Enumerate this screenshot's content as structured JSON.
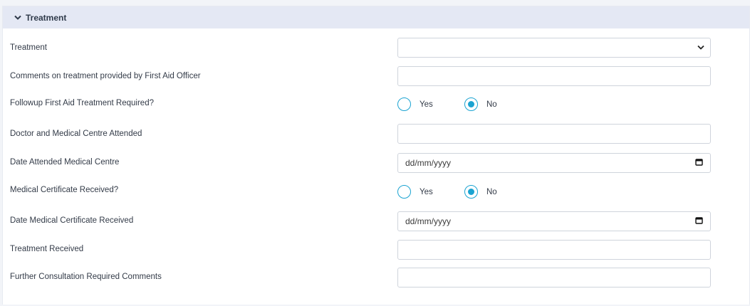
{
  "section": {
    "title": "Treatment",
    "expanded": true
  },
  "fields": {
    "treatment": {
      "label": "Treatment",
      "value": ""
    },
    "comments": {
      "label": "Comments on treatment provided by First Aid Officer",
      "value": ""
    },
    "followup": {
      "label": "Followup First Aid Treatment Required?",
      "yes_label": "Yes",
      "no_label": "No",
      "selected": "No"
    },
    "doctor": {
      "label": "Doctor and Medical Centre Attended",
      "value": ""
    },
    "date_attended": {
      "label": "Date Attended Medical Centre",
      "placeholder": "dd/mm/yyyy"
    },
    "certificate": {
      "label": "Medical Certificate Received?",
      "yes_label": "Yes",
      "no_label": "No",
      "selected": "No"
    },
    "date_certificate": {
      "label": "Date Medical Certificate Received",
      "placeholder": "dd/mm/yyyy"
    },
    "treatment_received": {
      "label": "Treatment Received",
      "value": ""
    },
    "further_comments": {
      "label": "Further Consultation Required Comments",
      "value": ""
    }
  },
  "colors": {
    "accent": "#1aa3d1",
    "header_bg": "#e4e8f4",
    "border": "#cfd4dc"
  },
  "icons": {
    "collapse": "chevron-down-icon",
    "select": "chevron-down-icon",
    "calendar": "calendar-icon"
  }
}
